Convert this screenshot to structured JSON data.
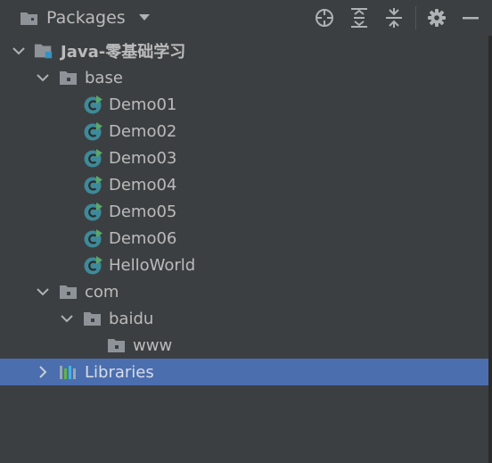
{
  "toolbar": {
    "view_title": "Packages",
    "icons": [
      "packages-icon",
      "chevron-down-icon",
      "locate-icon",
      "expand-all-icon",
      "collapse-all-icon",
      "gear-icon",
      "minimize-icon"
    ]
  },
  "tree": {
    "project": "Java-零基础学习",
    "base": "base",
    "classes": [
      "Demo01",
      "Demo02",
      "Demo03",
      "Demo04",
      "Demo05",
      "Demo06",
      "HelloWorld"
    ],
    "com": "com",
    "baidu": "baidu",
    "www": "www",
    "libraries": "Libraries"
  },
  "colors": {
    "background": "#3c3f41",
    "selection": "#4b6eaf",
    "class_icon": "#3d8a9a",
    "run_marker": "#59a869",
    "project_badge": "#3592c4"
  }
}
